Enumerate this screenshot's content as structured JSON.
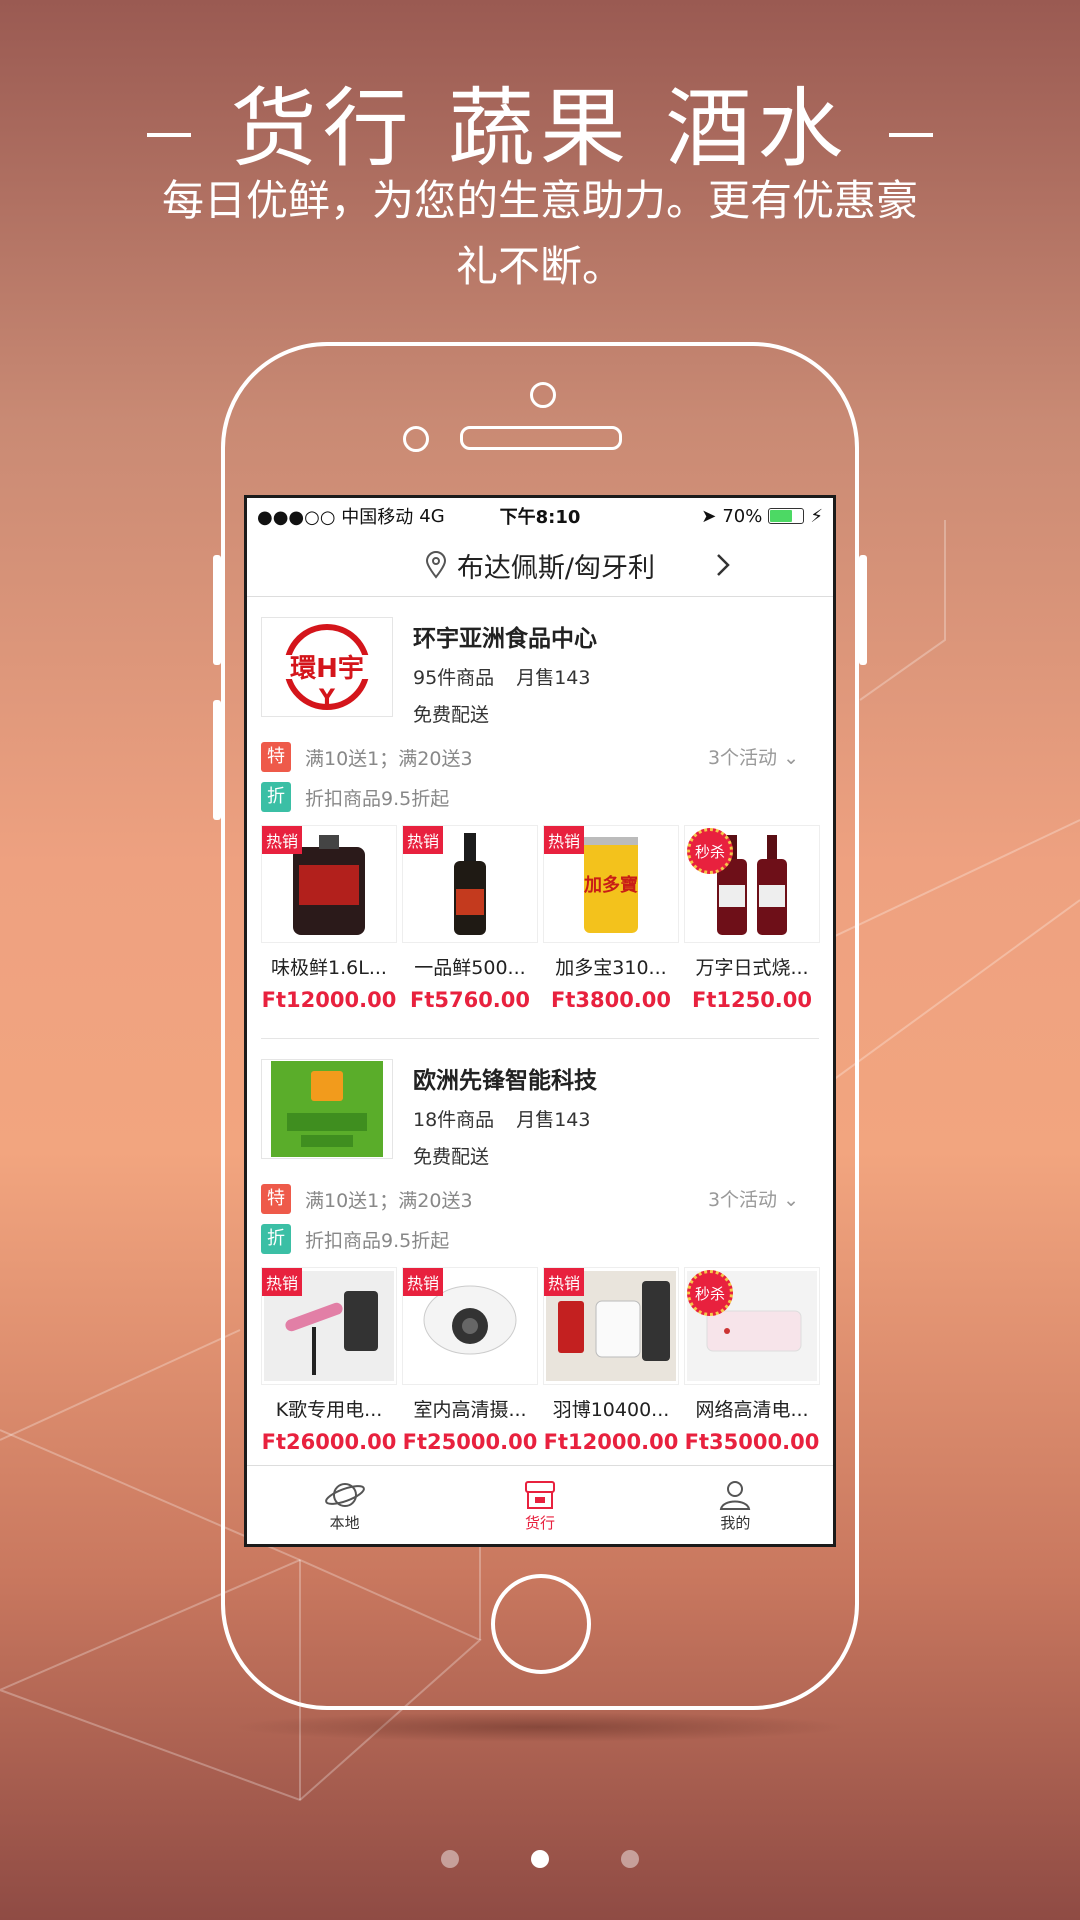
{
  "headline": "货行 蔬果 酒水",
  "subline": "每日优鲜，为您的生意助力。更有优惠豪礼不断。",
  "status": {
    "carrier": "●●●○○ 中国移动",
    "network": "4G",
    "time": "下午8:10",
    "battery": "70%"
  },
  "location": {
    "city": "布达佩斯/匈牙利"
  },
  "shops": [
    {
      "name": "环宇亚洲食品中心",
      "count": "95件商品",
      "monthly": "月售143",
      "shipping": "免费配送",
      "promo1_tag": "特",
      "promo1": "满10送1；满20送3",
      "promo2_tag": "折",
      "promo2": "折扣商品9.5折起",
      "activities": "3个活动",
      "products": [
        {
          "badge": "热销",
          "name": "味极鲜1.6L...",
          "price": "Ft12000.00"
        },
        {
          "badge": "热销",
          "name": "一品鲜500...",
          "price": "Ft5760.00"
        },
        {
          "badge": "热销",
          "name": "加多宝310...",
          "price": "Ft3800.00"
        },
        {
          "badge": "秒杀",
          "name": "万字日式烧...",
          "price": "Ft1250.00"
        }
      ]
    },
    {
      "name": "欧洲先锋智能科技",
      "count": "18件商品",
      "monthly": "月售143",
      "shipping": "免费配送",
      "promo1_tag": "特",
      "promo1": "满10送1；满20送3",
      "promo2_tag": "折",
      "promo2": "折扣商品9.5折起",
      "activities": "3个活动",
      "products": [
        {
          "badge": "热销",
          "name": "K歌专用电...",
          "price": "Ft26000.00"
        },
        {
          "badge": "热销",
          "name": "室内高清摄...",
          "price": "Ft25000.00"
        },
        {
          "badge": "热销",
          "name": "羽博10400...",
          "price": "Ft12000.00"
        },
        {
          "badge": "秒杀",
          "name": "网络高清电...",
          "price": "Ft35000.00"
        }
      ]
    }
  ],
  "tabs": [
    {
      "label": "本地",
      "icon": "planet-icon"
    },
    {
      "label": "货行",
      "icon": "shop-icon"
    },
    {
      "label": "我的",
      "icon": "user-icon"
    }
  ],
  "colors": {
    "accent": "#e8213e",
    "promo_red": "#ee5a4a",
    "promo_green": "#3bbfa5"
  }
}
